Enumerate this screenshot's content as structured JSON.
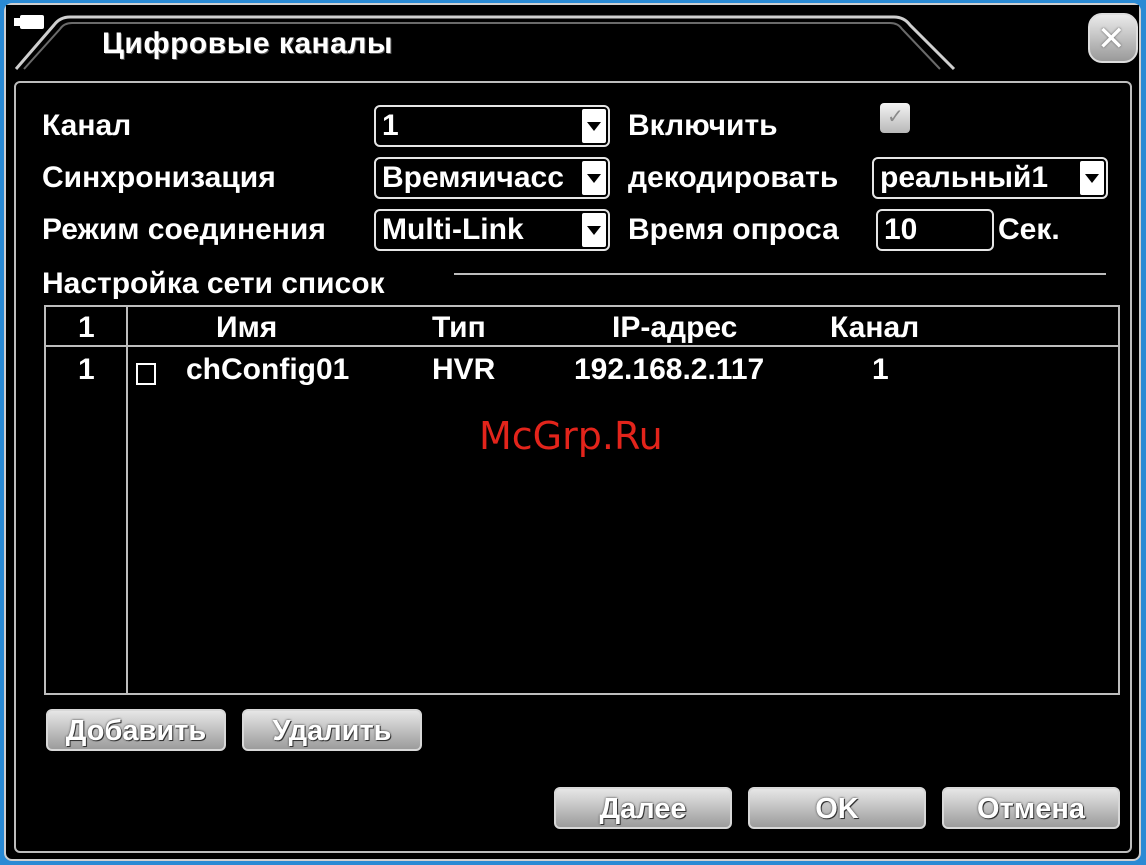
{
  "window": {
    "title": "Цифровые каналы",
    "close_label": "✕"
  },
  "form": {
    "channel_label": "Канал",
    "channel_value": "1",
    "enable_label": "Включить",
    "enable_checked": true,
    "sync_label": "Синхронизация",
    "sync_value": "Времяичасс",
    "decode_label": "декодировать",
    "decode_value": "реальный1",
    "connection_mode_label": "Режим соединения",
    "connection_mode_value": "Multi-Link",
    "poll_time_label": "Время опроса",
    "poll_time_value": "10",
    "poll_time_unit": "Сек."
  },
  "network_list": {
    "section_title": "Настройка сети список",
    "columns": {
      "index": "1",
      "name": "Имя",
      "type": "Тип",
      "ip": "IP-адрес",
      "channel": "Канал"
    },
    "rows": [
      {
        "index": "1",
        "checked": false,
        "name": "chConfig01",
        "type": "HVR",
        "ip": "192.168.2.117",
        "channel": "1"
      }
    ]
  },
  "buttons": {
    "add": "Добавить",
    "delete": "Удалить",
    "next": "Далее",
    "ok": "OK",
    "cancel": "Отмена"
  },
  "watermark": "McGrp.Ru"
}
